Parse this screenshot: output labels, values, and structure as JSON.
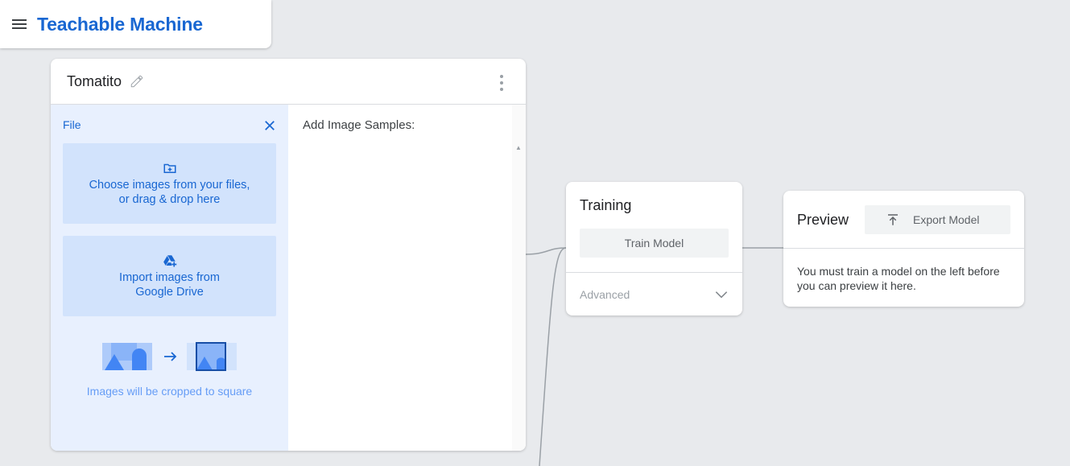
{
  "app": {
    "title": "Teachable Machine"
  },
  "class_card": {
    "name": "Tomatito",
    "file_panel": {
      "title": "File",
      "upload_files_line1": "Choose images from your files,",
      "upload_files_line2": "or drag & drop here",
      "drive_line1": "Import images from",
      "drive_line2": "Google Drive",
      "crop_note": "Images will be cropped to square"
    },
    "samples_label": "Add Image Samples:"
  },
  "training": {
    "title": "Training",
    "train_button": "Train Model",
    "advanced_label": "Advanced"
  },
  "preview": {
    "title": "Preview",
    "export_button": "Export Model",
    "message": "You must train a model on the left before you can preview it here."
  },
  "colors": {
    "brand": "#1967d2",
    "background": "#e8eaed",
    "panel_blue": "#e8f0fe",
    "upload_blue": "#d2e3fc"
  },
  "icons": [
    "menu-icon",
    "pencil-icon",
    "kebab-icon",
    "close-icon",
    "folder-add-icon",
    "google-drive-add-icon",
    "chevron-down-icon",
    "export-upload-icon"
  ]
}
